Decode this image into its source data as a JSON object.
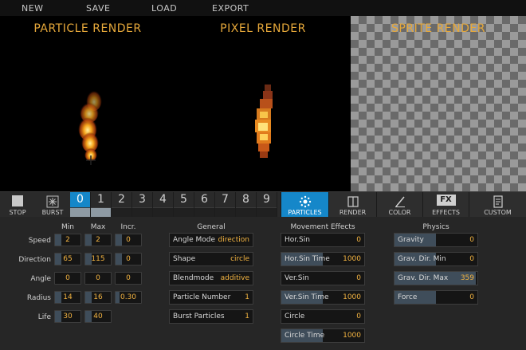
{
  "menu": {
    "new": "NEW",
    "save": "SAVE",
    "load": "LOAD",
    "export": "EXPORT"
  },
  "panes": {
    "particle": "PARTICLE RENDER",
    "pixel": "PIXEL RENDER",
    "sprite": "SPRITE RENDER"
  },
  "toolbar": {
    "stop": "STOP",
    "burst": "BURST",
    "emitters": [
      "0",
      "1",
      "2",
      "3",
      "4",
      "5",
      "6",
      "7",
      "8",
      "9"
    ],
    "particles": "PARTICLES",
    "render": "RENDER",
    "color": "COLOR",
    "effects": "EFFECTS",
    "custom": "CUSTOM",
    "fx_badge": "FX"
  },
  "ranges": {
    "headers": {
      "min": "Min",
      "max": "Max",
      "incr": "Incr."
    },
    "rows": [
      {
        "label": "Speed",
        "min": "2",
        "max": "2",
        "incr": "0"
      },
      {
        "label": "Direction",
        "min": "65",
        "max": "115",
        "incr": "0"
      },
      {
        "label": "Angle",
        "min": "0",
        "max": "0",
        "incr": "0"
      },
      {
        "label": "Radius",
        "min": "14",
        "max": "16",
        "incr": "0.30"
      },
      {
        "label": "Life",
        "min": "30",
        "max": "40",
        "incr": ""
      }
    ]
  },
  "general": {
    "title": "General",
    "items": [
      {
        "label": "Angle Mode",
        "value": "direction"
      },
      {
        "label": "Shape",
        "value": "circle"
      },
      {
        "label": "Blendmode",
        "value": "additive"
      },
      {
        "label": "Particle Number",
        "value": "1"
      },
      {
        "label": "Burst Particles",
        "value": "1"
      }
    ]
  },
  "movement": {
    "title": "Movement Effects",
    "items": [
      {
        "label": "Hor.Sin",
        "value": "0",
        "fill": 0
      },
      {
        "label": "Hor.Sin Time",
        "value": "1000",
        "fill": 0.5
      },
      {
        "label": "Ver.Sin",
        "value": "0",
        "fill": 0
      },
      {
        "label": "Ver.Sin Time",
        "value": "1000",
        "fill": 0.5
      },
      {
        "label": "Circle",
        "value": "0",
        "fill": 0
      },
      {
        "label": "Circle Time",
        "value": "1000",
        "fill": 0.5
      }
    ]
  },
  "physics": {
    "title": "Physics",
    "items": [
      {
        "label": "Gravity",
        "value": "0",
        "fill": 0.5
      },
      {
        "label": "Grav. Dir. Min",
        "value": "0",
        "fill": 0.5
      },
      {
        "label": "Grav. Dir. Max",
        "value": "359",
        "fill": 0.98
      },
      {
        "label": "Force",
        "value": "0",
        "fill": 0.5
      }
    ]
  },
  "colors": {
    "accent": "#1587c9",
    "value": "#f2b341",
    "title": "#e6a83a"
  }
}
